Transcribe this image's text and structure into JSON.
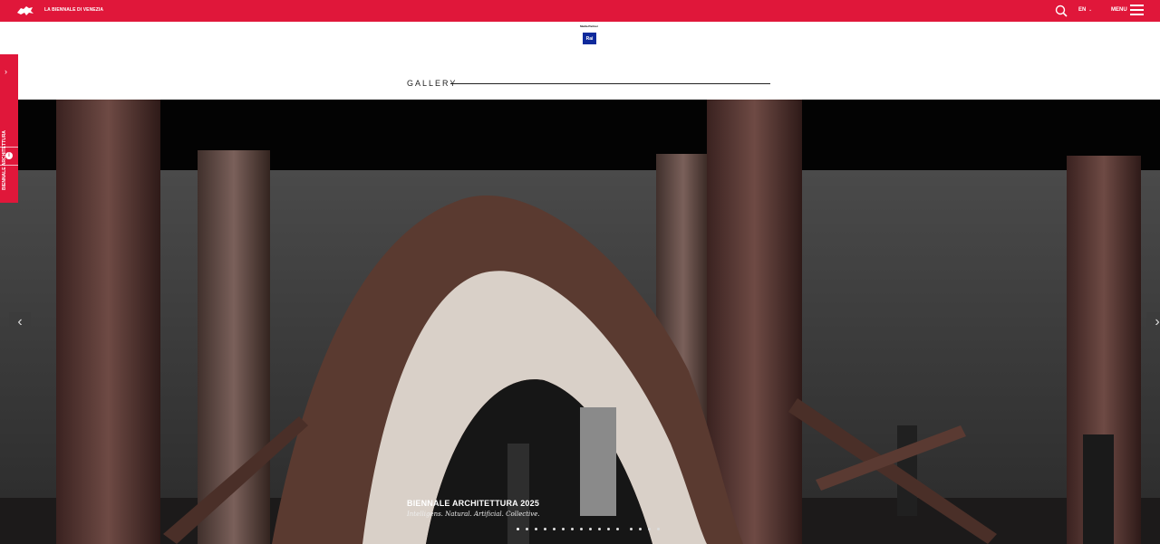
{
  "header": {
    "brand": "LA BIENNALE DI VENEZIA",
    "lang": "EN",
    "menu_label": "MENU",
    "icons": [
      "lion-logo-icon",
      "search-icon",
      "chevron-down-icon",
      "hamburger-menu-icon"
    ],
    "accent_color": "#e0173a"
  },
  "partner": {
    "label": "Media Partner",
    "logo_text": "Rai"
  },
  "gallery": {
    "title": "GALLERY"
  },
  "side_tab": {
    "label": "BIENNALE ARCHITETTURA",
    "icons": [
      "chevron-right-icon",
      "info-icon"
    ]
  },
  "slideshow": {
    "caption_title": "BIENNALE ARCHITETTURA 2025",
    "caption_subtitle": "Intelligens. Natural. Artificial. Collective.",
    "slide_count": 16,
    "active_slide": 1,
    "icons": [
      "chevron-left-icon",
      "chevron-right-icon"
    ]
  }
}
